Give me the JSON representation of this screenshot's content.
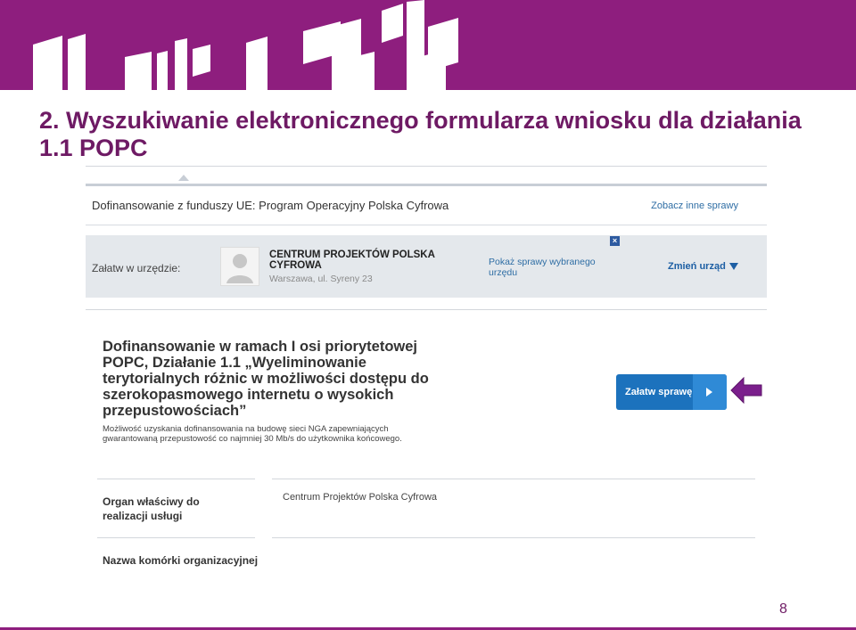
{
  "slide": {
    "title": "2. Wyszukiwanie elektronicznego formularza wniosku dla działania 1.1 POPC",
    "page_number": "8"
  },
  "colors": {
    "brand_purple": "#8e1e7e",
    "title_purple": "#6e1a64",
    "button_blue": "#1c72bd",
    "arrow_purple": "#7b1f8c"
  },
  "header": {
    "program_title": "Dofinansowanie z funduszy UE: Program Operacyjny Polska Cyfrowa",
    "other_cases_link": "Zobacz inne sprawy"
  },
  "office": {
    "label": "Załatw w urzędzie:",
    "name": "CENTRUM PROJEKTÓW POLSKA CYFROWA",
    "address": "Warszawa, ul. Syreny 23",
    "show_cases_link": "Pokaż sprawy wybranego urzędu",
    "change_office": "Zmień urząd",
    "avatar_icon": "user-avatar-icon",
    "close_icon": "close-icon"
  },
  "service": {
    "title": "Dofinansowanie w ramach I osi priorytetowej POPC, Działanie 1.1 „Wyeliminowanie terytorialnych różnic w możliwości dostępu do szerokopasmowego internetu o wysokich przepustowościach”",
    "description": "Możliwość uzyskania dofinansowania na budowę sieci NGA zapewniających gwarantowaną przepustowość co najmniej 30 Mb/s do użytkownika końcowego.",
    "button_label": "Załatw sprawę",
    "button_icon": "play-icon",
    "pointer_icon": "left-arrow-icon"
  },
  "details": {
    "rows": [
      {
        "label": "Organ właściwy do realizacji usługi",
        "value": "Centrum Projektów Polska Cyfrowa"
      },
      {
        "label": "Nazwa komórki organizacyjnej",
        "value": ""
      }
    ]
  }
}
